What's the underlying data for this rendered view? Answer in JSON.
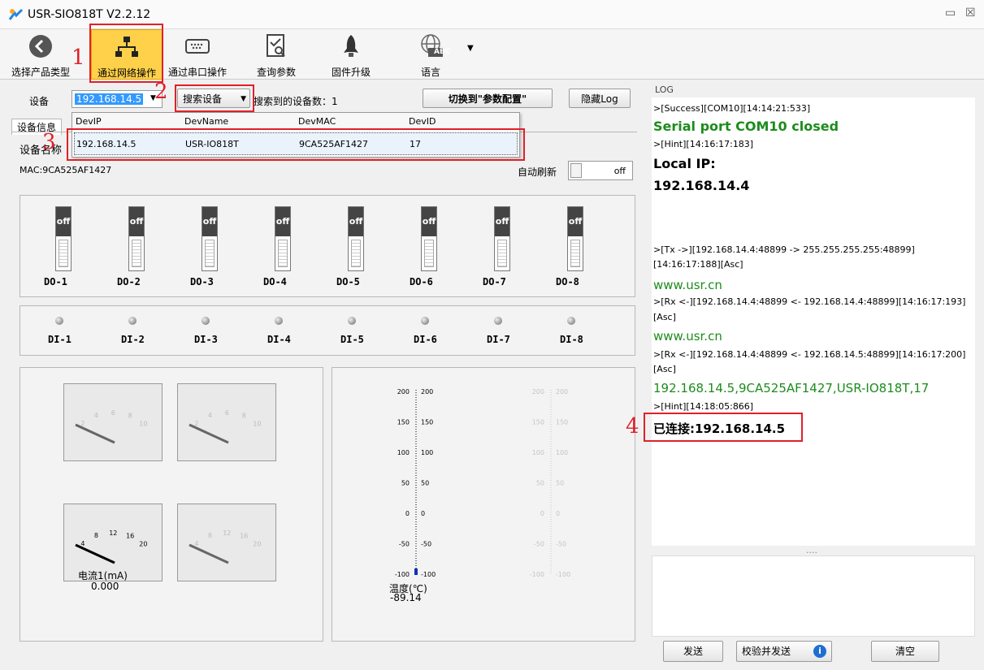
{
  "window": {
    "title": "USR-SIO818T V2.2.12",
    "minimize": "▭",
    "close": "☒"
  },
  "toolbar": {
    "items": [
      {
        "label": "选择产品类型"
      },
      {
        "label": "通过网络操作"
      },
      {
        "label": "通过串口操作"
      },
      {
        "label": "查询参数"
      },
      {
        "label": "固件升级"
      },
      {
        "label": "语言"
      }
    ],
    "language_badge": "ABC"
  },
  "annotations": [
    "1",
    "2",
    "3",
    "4"
  ],
  "device_row": {
    "label": "设备",
    "value": "192.168.14.5",
    "search_button": "搜索设备",
    "found_label": "搜索到的设备数：1",
    "switch_button": "切换到\"参数配置\"",
    "hide_log_button": "隐藏Log"
  },
  "device_info": {
    "tab": "设备信息",
    "name_label": "设备名称",
    "mac": "MAC:9CA525AF1427",
    "auto_refresh": "自动刷新",
    "auto_refresh_state": "off"
  },
  "dropdown": {
    "headers": [
      "DevIP",
      "DevName",
      "DevMAC",
      "DevID"
    ],
    "row": [
      "192.168.14.5",
      "USR-IO818T",
      "9CA525AF1427",
      "17"
    ]
  },
  "do_switches": [
    {
      "state": "off",
      "label": "DO-1"
    },
    {
      "state": "off",
      "label": "DO-2"
    },
    {
      "state": "off",
      "label": "DO-3"
    },
    {
      "state": "off",
      "label": "DO-4"
    },
    {
      "state": "off",
      "label": "DO-5"
    },
    {
      "state": "off",
      "label": "DO-6"
    },
    {
      "state": "off",
      "label": "DO-7"
    },
    {
      "state": "off",
      "label": "DO-8"
    }
  ],
  "di_inputs": [
    "DI-1",
    "DI-2",
    "DI-3",
    "DI-4",
    "DI-5",
    "DI-6",
    "DI-7",
    "DI-8"
  ],
  "meters": [
    {
      "scale": [
        "2",
        "4",
        "6",
        "8",
        "10"
      ],
      "caption": "",
      "value": ""
    },
    {
      "scale": [
        "2",
        "4",
        "6",
        "8",
        "10"
      ],
      "caption": "",
      "value": ""
    },
    {
      "scale": [
        "4",
        "8",
        "12",
        "16",
        "20"
      ],
      "caption": "电流1(mA)",
      "value": "0.000"
    },
    {
      "scale": [
        "4",
        "8",
        "12",
        "16",
        "20"
      ],
      "caption": "",
      "value": ""
    }
  ],
  "thermometers": {
    "ticks": [
      "200",
      "150",
      "100",
      "50",
      "0",
      "-50",
      "-100"
    ],
    "caption": "温度(℃)",
    "value": "-89.14"
  },
  "log": {
    "title": "LOG",
    "lines": [
      ">[Success][COM10][14:14:21:533]",
      "Serial port COM10 closed",
      ">[Hint][14:16:17:183]",
      "Local IP:",
      "192.168.14.4",
      ">[Tx ->][192.168.14.4:48899 -> 255.255.255.255:48899]",
      "[14:16:17:188][Asc]",
      "www.usr.cn",
      ">[Rx <-][192.168.14.4:48899 <- 192.168.14.4:48899][14:16:17:193]",
      "[Asc]",
      "www.usr.cn",
      ">[Rx <-][192.168.14.4:48899 <- 192.168.14.5:48899][14:16:17:200]",
      "[Asc]",
      "192.168.14.5,9CA525AF1427,USR-IO818T,17",
      ">[Hint][14:18:05:866]",
      "已连接:192.168.14.5"
    ],
    "splitter": "....",
    "send_button": "发送",
    "verify_send_button": "校验并发送",
    "info_icon": "i",
    "clear_button": "清空"
  }
}
